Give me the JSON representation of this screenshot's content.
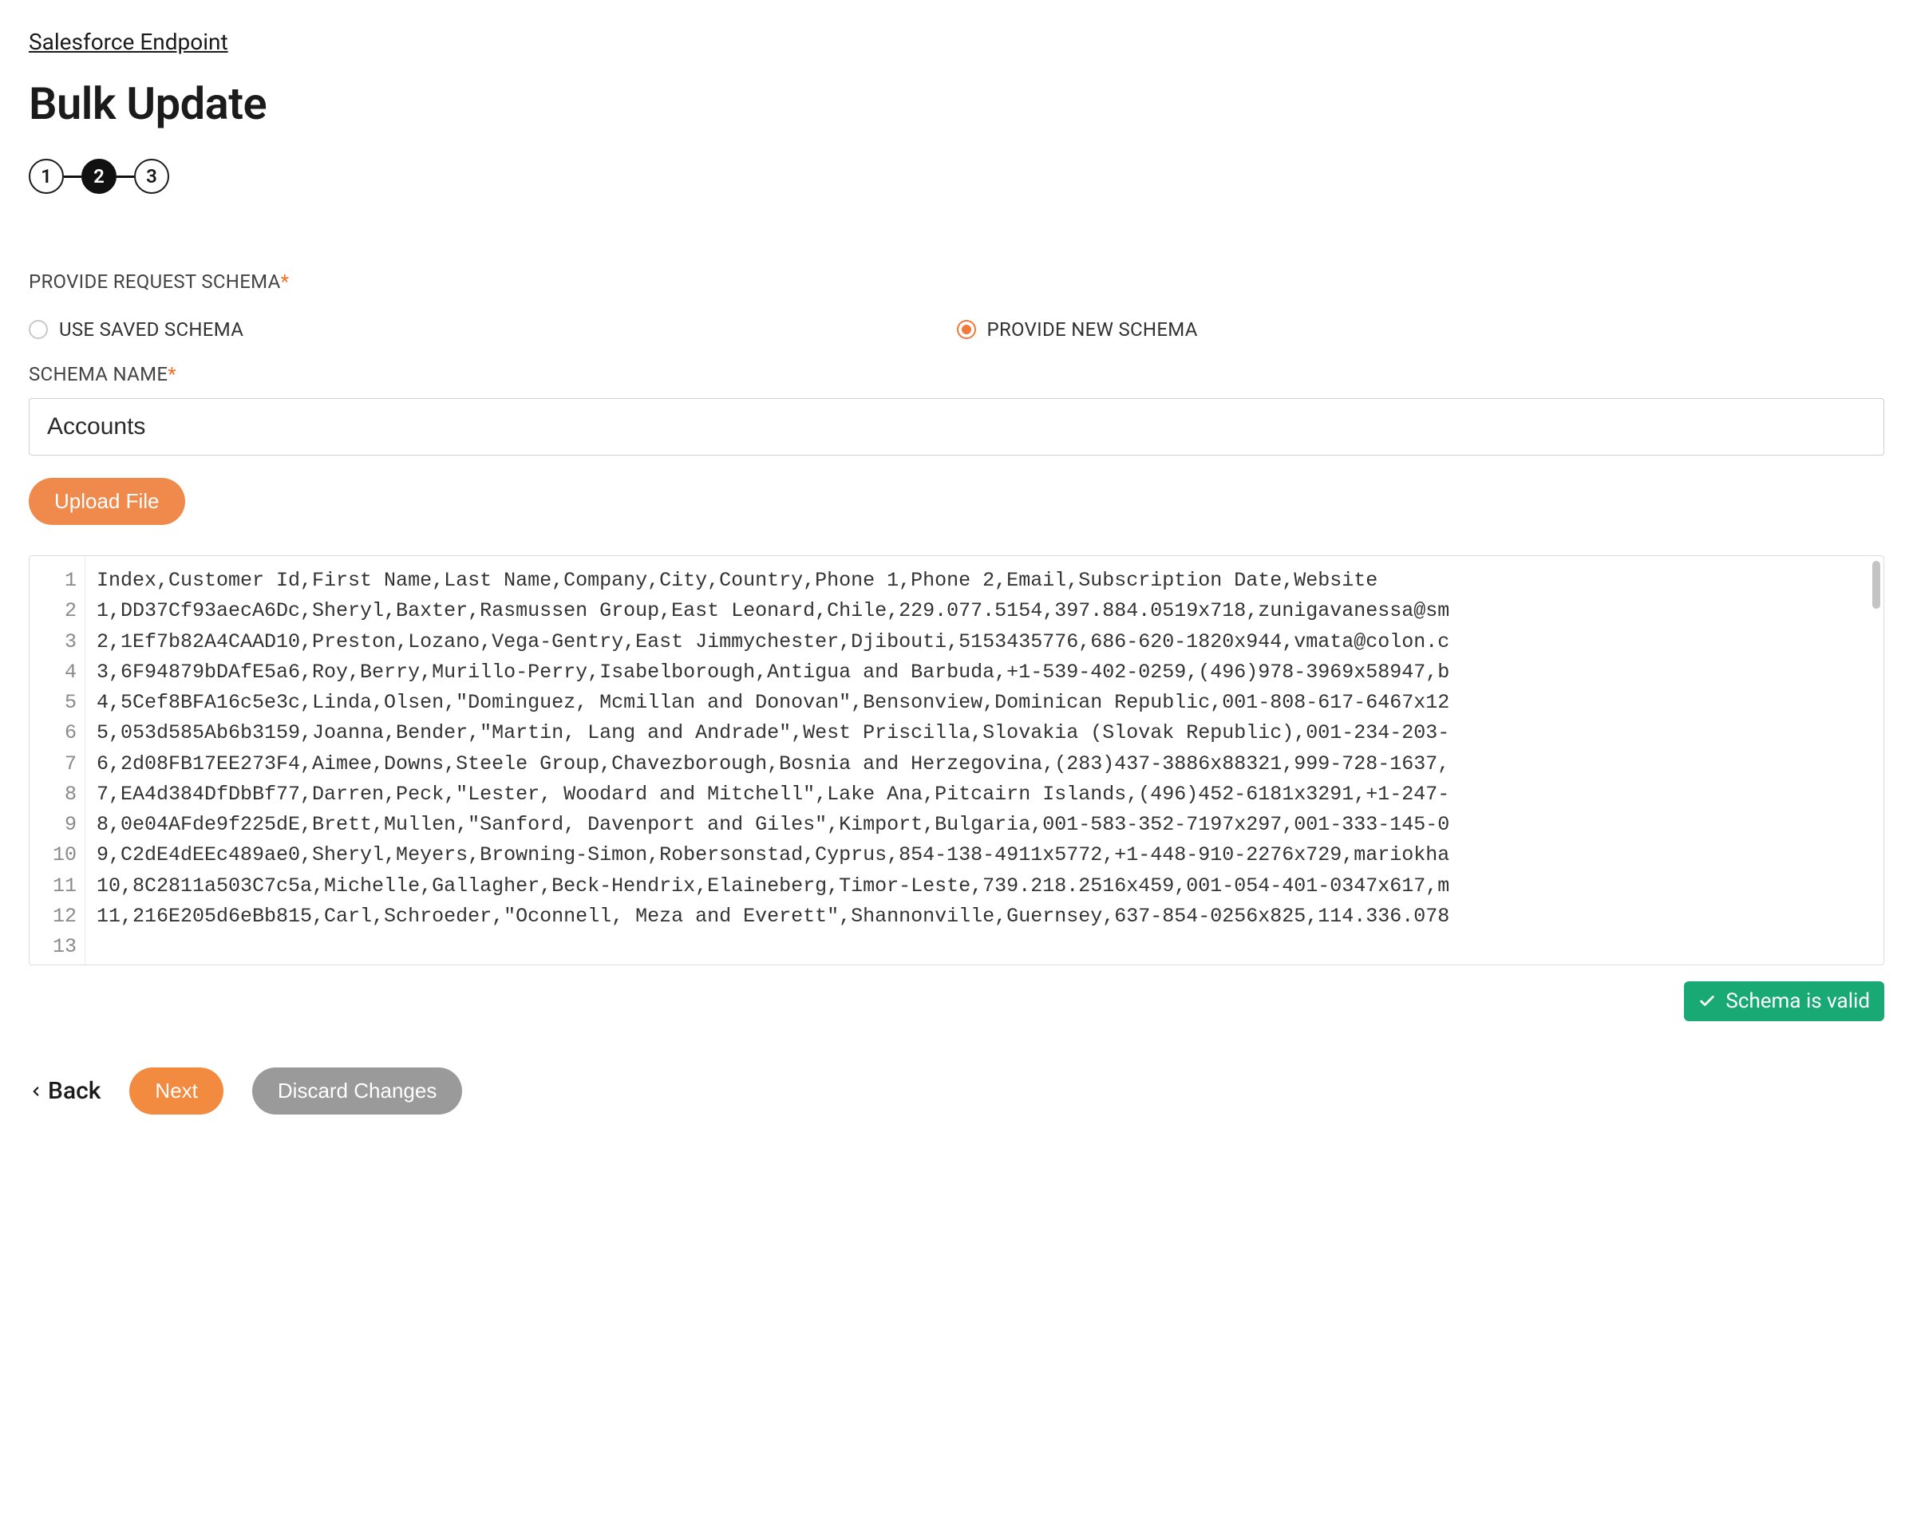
{
  "breadcrumb": {
    "label": "Salesforce Endpoint"
  },
  "page": {
    "title": "Bulk Update"
  },
  "stepper": {
    "steps": [
      "1",
      "2",
      "3"
    ],
    "current_index": 1
  },
  "schema_section": {
    "label": "PROVIDE REQUEST SCHEMA",
    "options": {
      "use_saved": "USE SAVED SCHEMA",
      "provide_new": "PROVIDE NEW SCHEMA"
    },
    "selected": "provide_new"
  },
  "schema_name": {
    "label": "SCHEMA NAME",
    "value": "Accounts"
  },
  "buttons": {
    "upload": "Upload File",
    "back": "Back",
    "next": "Next",
    "discard": "Discard Changes"
  },
  "validation": {
    "message": "Schema is valid"
  },
  "code": {
    "lines": [
      "Index,Customer Id,First Name,Last Name,Company,City,Country,Phone 1,Phone 2,Email,Subscription Date,Website",
      "1,DD37Cf93aecA6Dc,Sheryl,Baxter,Rasmussen Group,East Leonard,Chile,229.077.5154,397.884.0519x718,zunigavanessa@sm",
      "2,1Ef7b82A4CAAD10,Preston,Lozano,Vega-Gentry,East Jimmychester,Djibouti,5153435776,686-620-1820x944,vmata@colon.c",
      "3,6F94879bDAfE5a6,Roy,Berry,Murillo-Perry,Isabelborough,Antigua and Barbuda,+1-539-402-0259,(496)978-3969x58947,b",
      "4,5Cef8BFA16c5e3c,Linda,Olsen,\"Dominguez, Mcmillan and Donovan\",Bensonview,Dominican Republic,001-808-617-6467x12",
      "5,053d585Ab6b3159,Joanna,Bender,\"Martin, Lang and Andrade\",West Priscilla,Slovakia (Slovak Republic),001-234-203-",
      "6,2d08FB17EE273F4,Aimee,Downs,Steele Group,Chavezborough,Bosnia and Herzegovina,(283)437-3886x88321,999-728-1637,",
      "7,EA4d384DfDbBf77,Darren,Peck,\"Lester, Woodard and Mitchell\",Lake Ana,Pitcairn Islands,(496)452-6181x3291,+1-247-",
      "8,0e04AFde9f225dE,Brett,Mullen,\"Sanford, Davenport and Giles\",Kimport,Bulgaria,001-583-352-7197x297,001-333-145-0",
      "9,C2dE4dEEc489ae0,Sheryl,Meyers,Browning-Simon,Robersonstad,Cyprus,854-138-4911x5772,+1-448-910-2276x729,mariokha",
      "10,8C2811a503C7c5a,Michelle,Gallagher,Beck-Hendrix,Elaineberg,Timor-Leste,739.218.2516x459,001-054-401-0347x617,m",
      "11,216E205d6eBb815,Carl,Schroeder,\"Oconnell, Meza and Everett\",Shannonville,Guernsey,637-854-0256x825,114.336.078",
      ""
    ],
    "line_numbers": [
      "1",
      "2",
      "3",
      "4",
      "5",
      "6",
      "7",
      "8",
      "9",
      "10",
      "11",
      "12",
      "13"
    ]
  }
}
